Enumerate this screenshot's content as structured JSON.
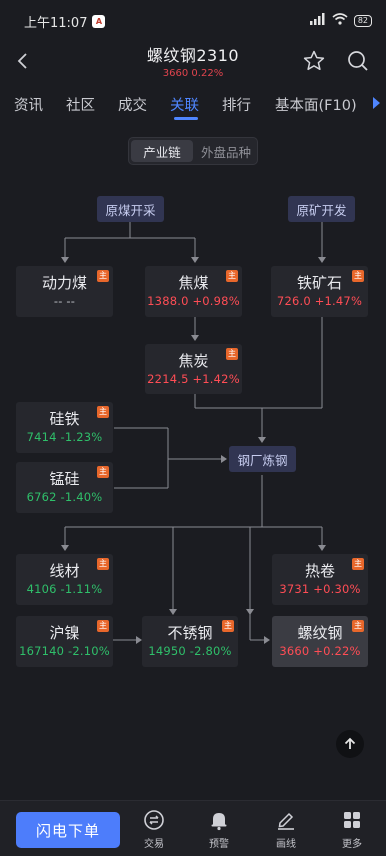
{
  "status_bar": {
    "time": "上午11:07",
    "app_badge": "A",
    "battery": "82"
  },
  "header": {
    "title": "螺纹钢2310",
    "subtitle": "3660  0.22%"
  },
  "tabs": [
    {
      "label": "资讯",
      "active": false
    },
    {
      "label": "社区",
      "active": false
    },
    {
      "label": "成交",
      "active": false
    },
    {
      "label": "关联",
      "active": true
    },
    {
      "label": "排行",
      "active": false
    },
    {
      "label": "基本面(F10)",
      "active": false
    }
  ],
  "segment": {
    "items": [
      "产业链",
      "外盘品种"
    ],
    "active": "产业链"
  },
  "chain": {
    "source_coal": "原煤开采",
    "source_ore": "原矿开发",
    "steel_mill": "钢厂炼钢",
    "badge_char": "主",
    "products": [
      {
        "name": "动力煤",
        "quote": "-- --",
        "trend": "flat"
      },
      {
        "name": "焦煤",
        "quote": "1388.0 +0.98%",
        "trend": "up"
      },
      {
        "name": "铁矿石",
        "quote": "726.0 +1.47%",
        "trend": "up"
      },
      {
        "name": "焦炭",
        "quote": "2214.5 +1.42%",
        "trend": "up"
      },
      {
        "name": "硅铁",
        "quote": "7414 -1.23%",
        "trend": "down"
      },
      {
        "name": "锰硅",
        "quote": "6762 -1.40%",
        "trend": "down"
      },
      {
        "name": "线材",
        "quote": "4106 -1.11%",
        "trend": "down"
      },
      {
        "name": "热卷",
        "quote": "3731 +0.30%",
        "trend": "up"
      },
      {
        "name": "沪镍",
        "quote": "167140 -2.10%",
        "trend": "down"
      },
      {
        "name": "不锈钢",
        "quote": "14950 -2.80%",
        "trend": "down"
      },
      {
        "name": "螺纹钢",
        "quote": "3660 +0.22%",
        "trend": "up"
      }
    ]
  },
  "bottom_bar": {
    "flash_order": "闪电下单",
    "nav": [
      "交易",
      "预警",
      "画线",
      "更多"
    ]
  }
}
